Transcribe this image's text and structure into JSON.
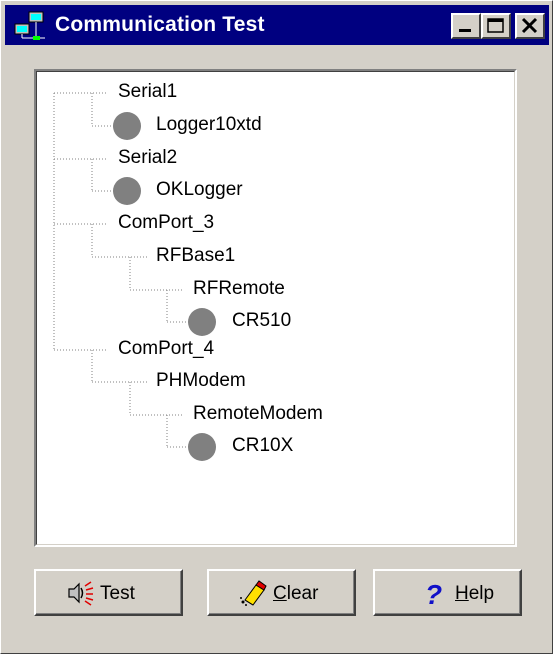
{
  "window": {
    "title": "Communication Test",
    "controls": [
      "minimize-icon",
      "maximize-icon",
      "close-icon"
    ]
  },
  "tree": {
    "nodes": [
      {
        "label": "Serial1",
        "level": 0,
        "connected_icon": false
      },
      {
        "label": "Logger10xtd",
        "level": 1,
        "connected_icon": true
      },
      {
        "label": "Serial2",
        "level": 0,
        "connected_icon": false
      },
      {
        "label": "OKLogger",
        "level": 1,
        "connected_icon": true
      },
      {
        "label": "ComPort_3",
        "level": 0,
        "connected_icon": false
      },
      {
        "label": "RFBase1",
        "level": 1,
        "connected_icon": false
      },
      {
        "label": "RFRemote",
        "level": 2,
        "connected_icon": false
      },
      {
        "label": "CR510",
        "level": 3,
        "connected_icon": true
      },
      {
        "label": "ComPort_4",
        "level": 0,
        "connected_icon": false
      },
      {
        "label": "PHModem",
        "level": 1,
        "connected_icon": false
      },
      {
        "label": "RemoteModem",
        "level": 2,
        "connected_icon": false
      },
      {
        "label": "CR10X",
        "level": 3,
        "connected_icon": true
      }
    ]
  },
  "buttons": {
    "test": {
      "label": "Test",
      "icon": "speaker-icon"
    },
    "clear": {
      "label_mnemonic": "C",
      "label_rest": "lear",
      "icon": "eraser-icon"
    },
    "help": {
      "label_mnemonic": "H",
      "label_rest": "elp",
      "icon": "question-icon"
    }
  },
  "colors": {
    "titlebar": "#000080",
    "face": "#d4d0c8",
    "node_circle": "#808080",
    "help_icon": "#1010c8"
  }
}
